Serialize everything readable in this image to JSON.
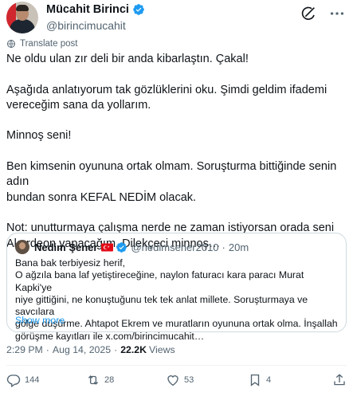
{
  "author": {
    "display_name": "Mücahit Birinci",
    "handle": "@birincimucahit",
    "verified_color": "#1d9bf0"
  },
  "translate_label": "Translate post",
  "tweet_lines": {
    "l1": "Ne oldu ulan zır deli bir anda kibarlaştın. Çakal!",
    "l2": "Aşağıda anlatıyorum tak gözlüklerini oku. Şimdi geldim ifademi",
    "l3": "vereceğim sana da yollarım.",
    "l4": "Minnoş seni!",
    "l5": "Ben kimsenin oyununa ortak olmam. Soruşturma bittiğinde senin adın",
    "l6": "bundan sonra KEFAL NEDİM olacak.",
    "l7": "Not: unutturmaya çalışma nerde ne zaman istiyorsan orada seni",
    "l8": "Akordeon yapacağım. Dilekçeci minnoş…"
  },
  "quote": {
    "name": "Nedim Şener",
    "handle": "@nedimsener2010",
    "separator": "·",
    "time": "20m",
    "lines": {
      "q1": "Bana bak terbiyesiz herif,",
      "q2": "O ağzıla bana laf yetiştireceğine, naylon faturacı kara paracı Murat Kapki'ye",
      "q3": "niye gittiğini, ne konuştuğunu tek tek anlat millete. Soruşturmaya ve savcılara",
      "q4": "gölge düşürme. Ahtapot Ekrem ve muratların oyununa ortak olma. İnşallah",
      "q5": "görüşme kayıtları ile x.com/birincimucahit…"
    },
    "show_more": "Show more"
  },
  "meta": {
    "time": "2:29 PM",
    "dot1": "·",
    "date": "Aug 14, 2025",
    "dot2": "·",
    "views_count": "22.2K",
    "views_label": "Views"
  },
  "actions": {
    "replies": "144",
    "reposts": "28",
    "likes": "53",
    "bookmarks": "4"
  },
  "icons": [
    "verified-badge-icon",
    "grok-icon",
    "more-icon",
    "globe-icon",
    "turkey-flag-icon",
    "reply-icon",
    "repost-icon",
    "like-icon",
    "bookmark-icon",
    "share-icon"
  ]
}
